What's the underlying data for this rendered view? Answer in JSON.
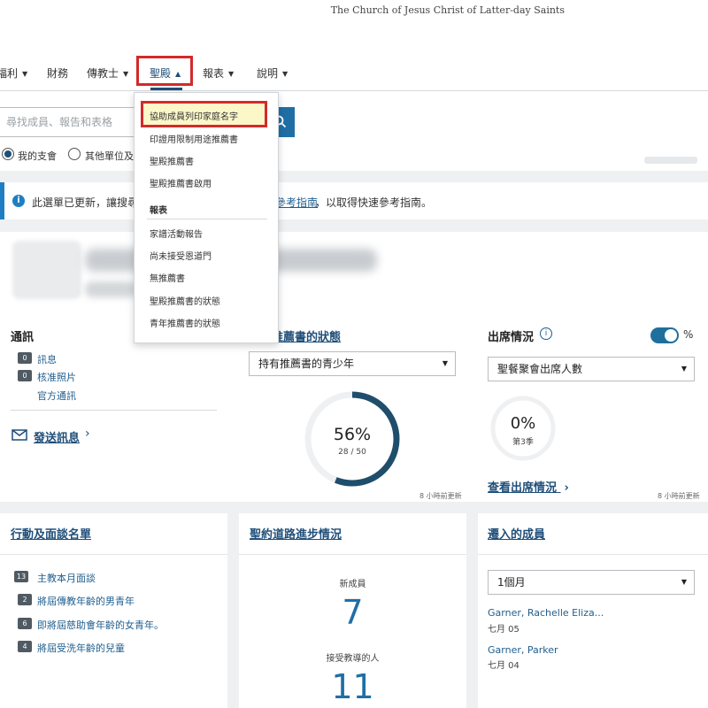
{
  "header": {
    "church_name": "The Church of Jesus Christ of Latter-day Saints"
  },
  "nav": {
    "items": [
      {
        "label": "福利",
        "caret": "▼"
      },
      {
        "label": "財務",
        "caret": ""
      },
      {
        "label": "傳教士",
        "caret": "▼"
      },
      {
        "label": "聖殿",
        "caret": "▲"
      },
      {
        "label": "報表",
        "caret": "▼"
      },
      {
        "label": "說明",
        "caret": "▼"
      }
    ]
  },
  "temple_menu": {
    "items": [
      "協助成員列印家庭名字",
      "印證用限制用途推薦書",
      "聖殿推薦書",
      "聖殿推薦書啟用"
    ],
    "section_header": "報表",
    "reports": [
      "家譜活動報告",
      "尚未接受恩道門",
      "無推薦書",
      "聖殿推薦書的狀態",
      "青年推薦書的狀態"
    ]
  },
  "search": {
    "placeholder": "尋找成員、報告和表格",
    "scope_options": [
      "我的支會",
      "其他單位及會員"
    ]
  },
  "banner": {
    "text_a": "此選單已更新，讓搜尋",
    "link": "參考指南",
    "text_b": "，以取得快速參考指南。"
  },
  "communications": {
    "title": "通訊",
    "items": [
      {
        "count": "0",
        "label": "訊息"
      },
      {
        "count": "0",
        "label": "核准照片"
      },
      {
        "count": "",
        "label": "官方通訊"
      }
    ],
    "send_label": "發送訊息",
    "chevron": "›"
  },
  "recommend_status": {
    "title": "推薦書的狀態",
    "select_value": "持有推薦書的青少年",
    "percent": "56%",
    "count": "28 / 50",
    "fraction": 0.56,
    "updated": "8 小時前更新"
  },
  "attendance": {
    "title": "出席情況",
    "toggle_label": "%",
    "select_value": "聖餐聚會出席人數",
    "percent": "0%",
    "sub": "第3季",
    "view_link": "查看出席情況",
    "chevron": "›",
    "updated": "8 小時前更新"
  },
  "action_list": {
    "title": "行動及面談名單",
    "items": [
      {
        "count": "13",
        "label": "主教本月面談"
      },
      {
        "count": "2",
        "label": "將屆傳教年齡的男青年"
      },
      {
        "count": "6",
        "label": "即將屆慈助會年齡的女青年。"
      },
      {
        "count": "4",
        "label": "將屆受洗年齡的兒童"
      }
    ]
  },
  "covenant_path": {
    "title": "聖約道路進步情況",
    "new_members_label": "新成員",
    "new_members": "7",
    "taught_label": "接受教導的人",
    "taught": "11"
  },
  "moved_in": {
    "title": "遷入的成員",
    "select_value": "1個月",
    "members": [
      {
        "name": "Garner, Rachelle Eliza...",
        "date": "七月 05"
      },
      {
        "name": "Garner, Parker",
        "date": "七月 04"
      }
    ]
  },
  "icons": {
    "search": "search-icon",
    "info": "info-icon",
    "mail": "mail-icon"
  },
  "colors": {
    "accent": "#1f4e79",
    "link": "#1f5e8e",
    "highlight_border": "#d22a2a",
    "ring": "#1f4e6b",
    "toggle": "#1f6f9c"
  }
}
